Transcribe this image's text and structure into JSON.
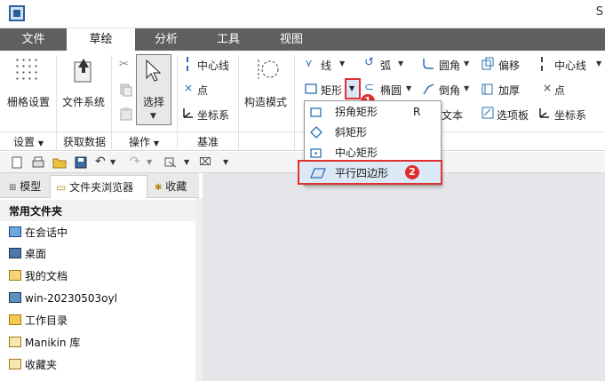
{
  "window": {
    "title_fragment": "S"
  },
  "tabs": [
    {
      "label": "文件",
      "active": false
    },
    {
      "label": "草绘",
      "active": true
    },
    {
      "label": "分析",
      "active": false
    },
    {
      "label": "工具",
      "active": false
    },
    {
      "label": "视图",
      "active": false
    }
  ],
  "ribbon": {
    "grid_settings": "栅格设置",
    "file_system": "文件系统",
    "select": "选择",
    "centerline": "中心线",
    "point": "点",
    "coord_system": "坐标系",
    "construct_mode": "构造模式",
    "line": "线",
    "arc": "弧",
    "fillet": "圆角",
    "offset": "偏移",
    "centerline2": "中心线",
    "rectangle": "矩形",
    "ellipse": "椭圆",
    "chamfer": "倒角",
    "thicken": "加厚",
    "point2": "点",
    "text": "文本",
    "palette": "选项板",
    "coord_system2": "坐标系",
    "groups": {
      "settings": "设置",
      "get_data": "获取数据",
      "operations": "操作",
      "datum": "基准"
    }
  },
  "dropdown": {
    "items": [
      {
        "label": "拐角矩形",
        "shortcut": "R"
      },
      {
        "label": "斜矩形",
        "shortcut": ""
      },
      {
        "label": "中心矩形",
        "shortcut": ""
      },
      {
        "label": "平行四边形",
        "shortcut": ""
      }
    ]
  },
  "annotations": {
    "badge1": "1",
    "badge2": "2"
  },
  "panel": {
    "tabs": [
      "模型",
      "文件夹浏览器",
      "收藏"
    ],
    "section_title": "常用文件夹",
    "folders": [
      {
        "label": "在会话中",
        "icon": "monitor-icon"
      },
      {
        "label": "桌面",
        "icon": "desktop-icon"
      },
      {
        "label": "我的文档",
        "icon": "documents-icon"
      },
      {
        "label": "win-20230503oyl",
        "icon": "computer-icon"
      },
      {
        "label": "工作目录",
        "icon": "working-dir-icon"
      },
      {
        "label": "Manikin 库",
        "icon": "library-icon"
      },
      {
        "label": "收藏夹",
        "icon": "favorites-icon"
      }
    ]
  },
  "colors": {
    "tabbar": "#5f5f5f",
    "highlight": "#e03030",
    "accent": "#2a6fb5"
  }
}
